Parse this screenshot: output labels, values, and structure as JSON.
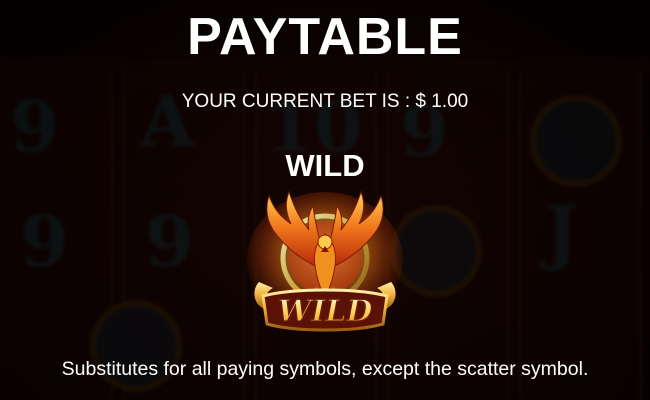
{
  "paytable": {
    "title": "PAYTABLE",
    "bet_label": "YOUR CURRENT BET IS : $ 1.00",
    "symbol": {
      "name": "WILD",
      "icon": "phoenix-wild-icon",
      "badge_text": "WILD",
      "description": "Substitutes for all paying symbols, except the scatter symbol."
    }
  },
  "colors": {
    "text": "#ffffff",
    "background": "#160504",
    "gold": "#f2b23a",
    "fire": "#e8521a"
  }
}
